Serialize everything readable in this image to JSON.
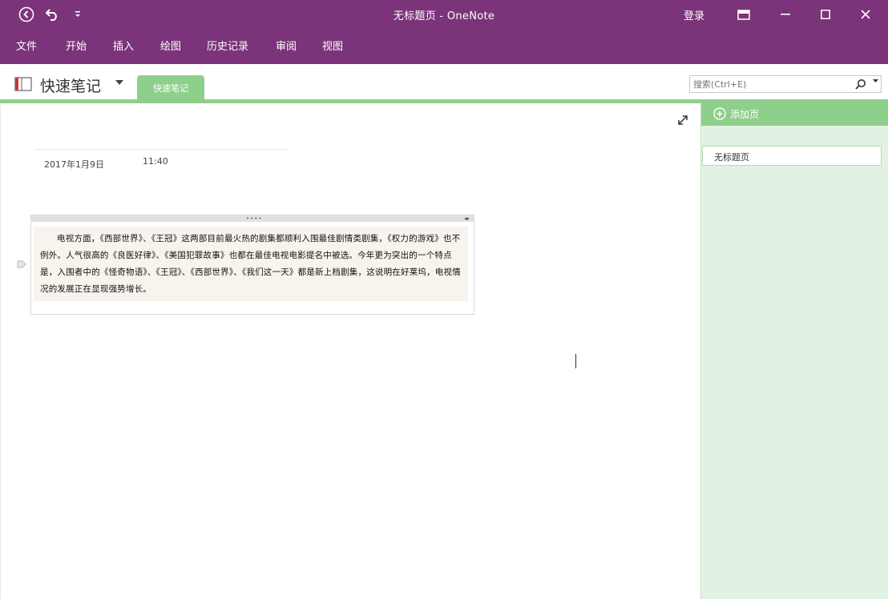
{
  "window": {
    "title": "无标题页 - OneNote",
    "signin_label": "登录",
    "icons": [
      "back-circle-icon",
      "undo-icon",
      "quick-access-dropdown-icon",
      "ribbon-display-icon",
      "minimize-icon",
      "maximize-icon",
      "close-icon"
    ]
  },
  "menu": {
    "items": [
      {
        "label": "文件"
      },
      {
        "label": "开始"
      },
      {
        "label": "插入"
      },
      {
        "label": "绘图"
      },
      {
        "label": "历史记录"
      },
      {
        "label": "审阅"
      },
      {
        "label": "视图"
      }
    ]
  },
  "notebook": {
    "name": "快速笔记",
    "section_tab": "快速笔记"
  },
  "search": {
    "placeholder": "搜索(Ctrl+E)"
  },
  "page": {
    "date": "2017年1月9日",
    "time": "11:40",
    "note_text": "电视方面，《西部世界》、《王冠》这两部目前最火热的剧集都顺利入围最佳剧情类剧集，《权力的游戏》也不例外。人气很高的《良医好律》、《美国犯罪故事》也都在最佳电视电影提名中被选。今年更为突出的一个特点是，入围者中的《怪奇物语》、《王冠》、《西部世界》、《我们这一天》都是新上档剧集，这说明在好莱坞，电视情况的发展正在显现强势增长。"
  },
  "pages_pane": {
    "add_page_label": "添加页",
    "pages": [
      {
        "title": "无标题页"
      }
    ]
  },
  "colors": {
    "title_bar": "#7b3479",
    "section_green": "#8fcf8c",
    "pane_bg": "#e2f2e2"
  }
}
